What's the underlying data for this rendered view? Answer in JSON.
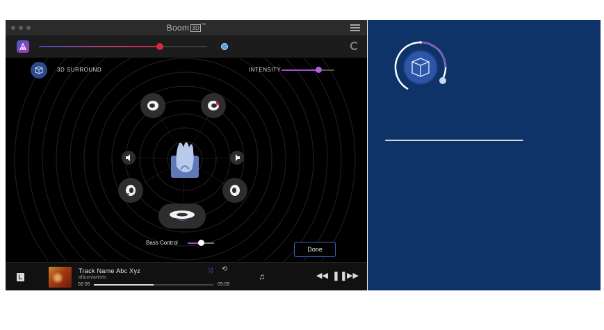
{
  "window": {
    "title": "Boom",
    "title_badge": "3D",
    "title_mark": "™"
  },
  "volume": {
    "level": 0.72
  },
  "surround": {
    "label": "3D SURROUND",
    "intensity_label": "INTENSITY",
    "intensity_level": 0.7
  },
  "speakers": [
    "front-left",
    "front-right",
    "side-left",
    "side-right",
    "rear-left",
    "rear-right",
    "subwoofer"
  ],
  "bass": {
    "label": "Bass Control",
    "level": 0.5
  },
  "done_label": "Done",
  "player": {
    "track_name": "Track Name Abc Xyz",
    "artist": "album/artists",
    "time_current": "02:05",
    "time_total": "05:05",
    "progress": 0.5
  },
  "icons": {
    "shuffle": "shuffle-icon",
    "repeat": "repeat-icon",
    "queue": "queue-icon",
    "previous": "rewind-icon",
    "pause": "pause-icon",
    "next": "fast-forward-icon"
  },
  "colors": {
    "accent_purple": "#a24ed0",
    "accent_blue": "#3e74d8",
    "panel_bg": "#0e3368",
    "volume_red": "#d42a3c"
  }
}
